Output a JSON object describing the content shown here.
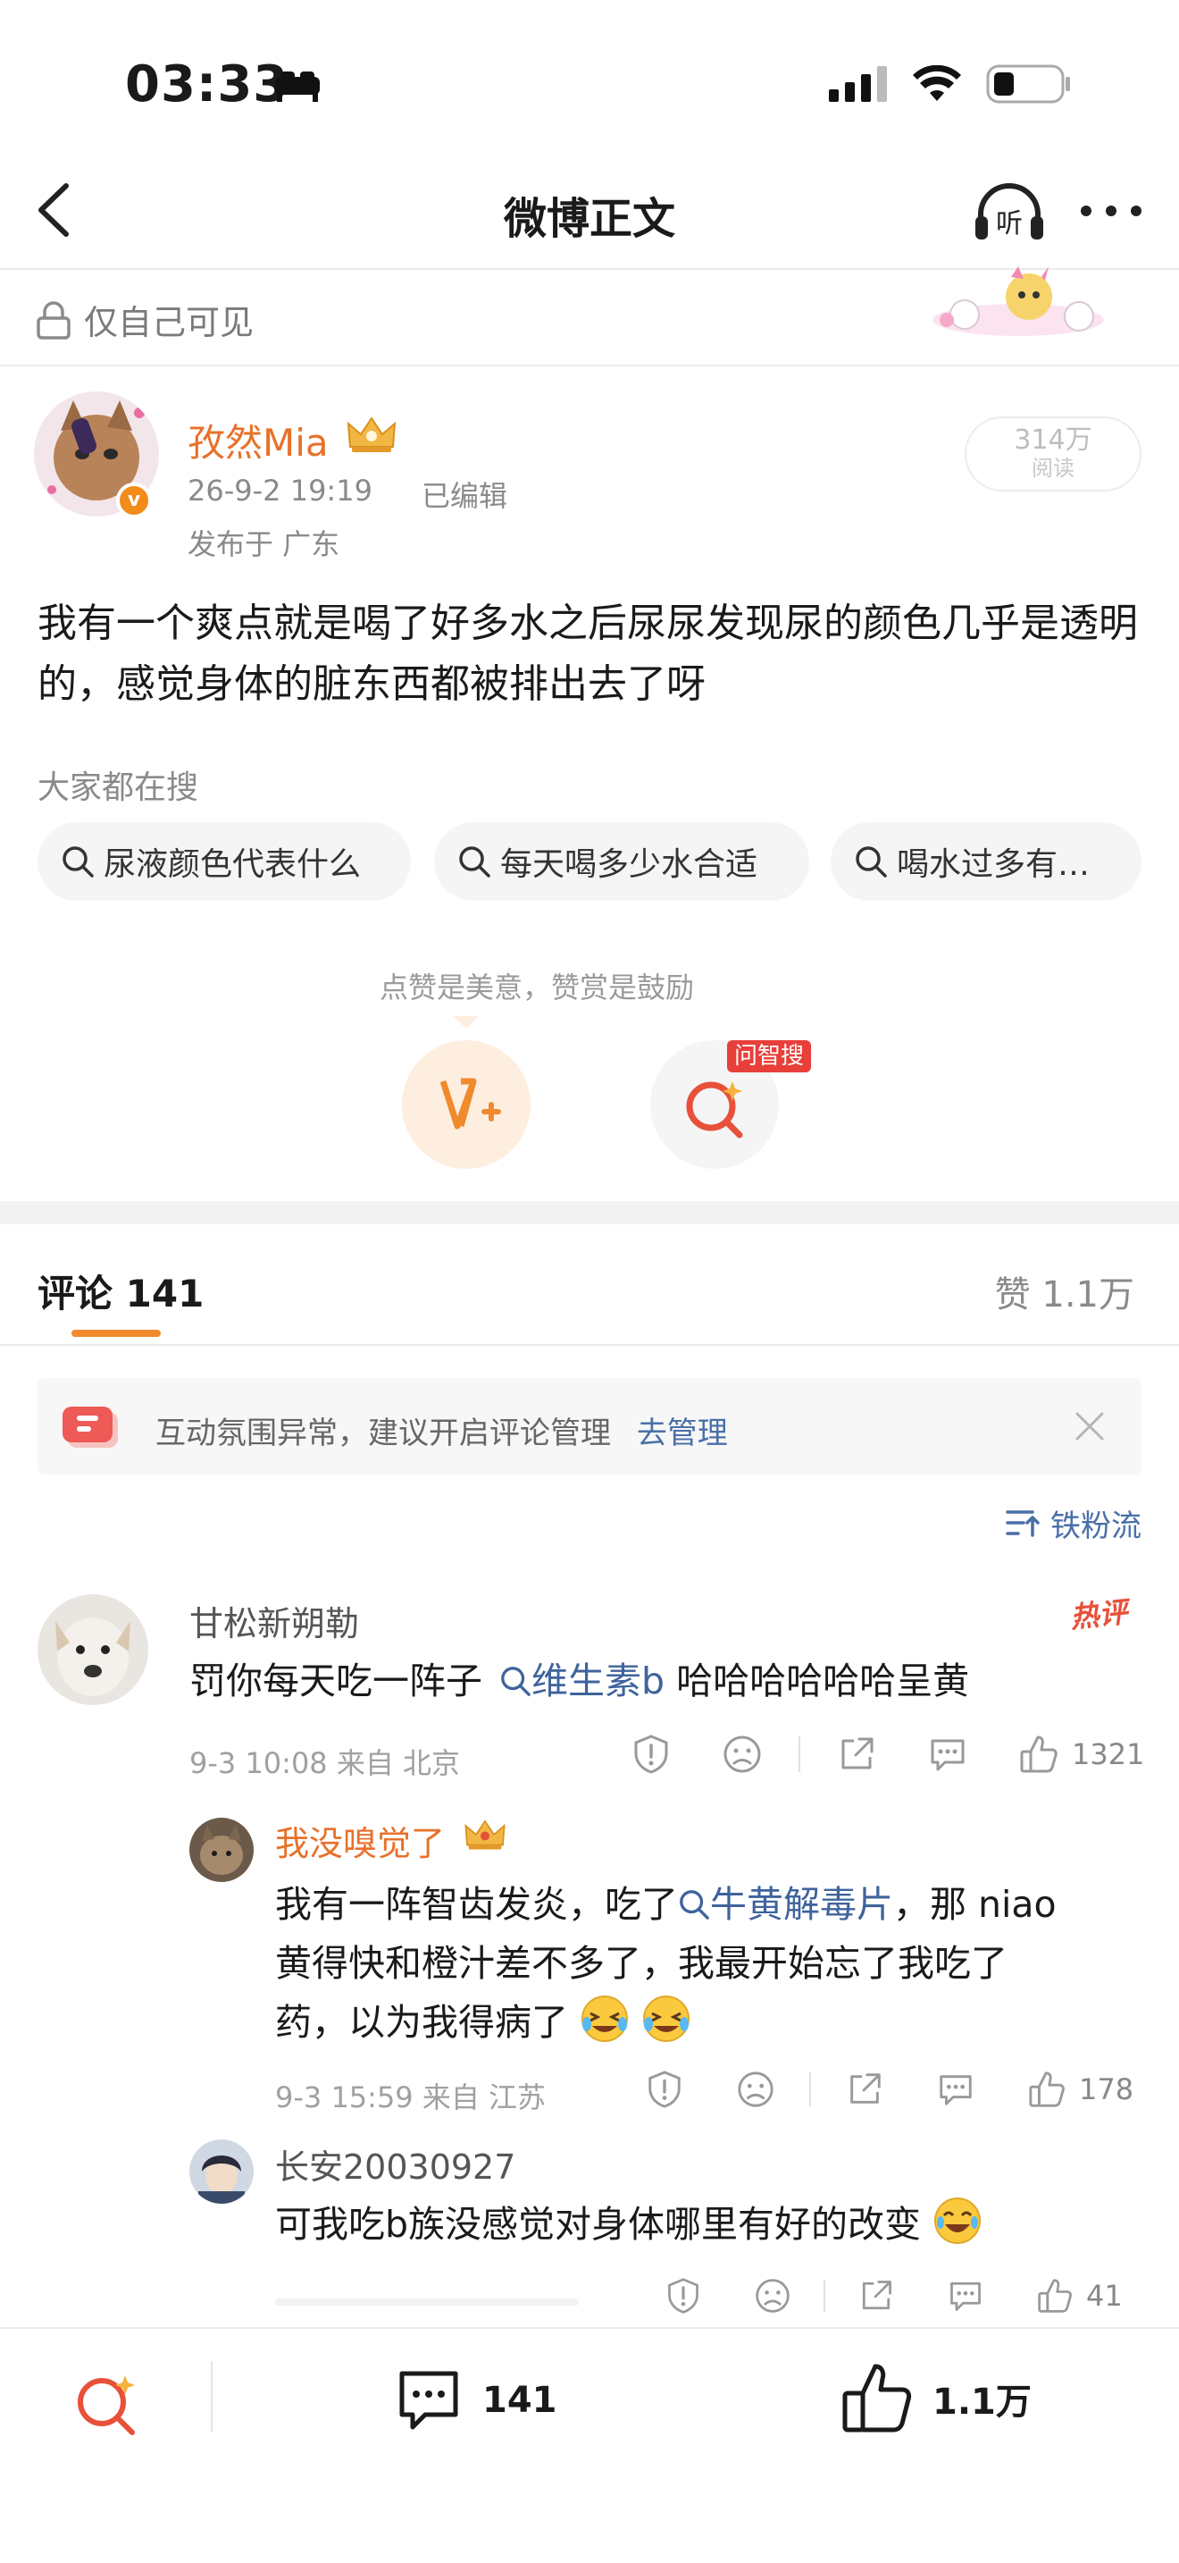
{
  "status": {
    "time": "03:33"
  },
  "nav": {
    "title": "微博正文"
  },
  "privacy": {
    "label": "仅自己可见"
  },
  "post": {
    "author": "孜然Mia",
    "time": "26-9-2 19:19",
    "edited": "已编辑",
    "location": "发布于 广东",
    "reads_number": "314万",
    "reads_label": "阅读",
    "body": "我有一个爽点就是喝了好多水之后尿尿发现尿的颜色几乎是透明的，感觉身体的脏东西都被排出去了呀"
  },
  "search": {
    "title": "大家都在搜",
    "chips": [
      "尿液颜色代表什么",
      "每天喝多少水合适",
      "喝水过多有…"
    ]
  },
  "reward": {
    "hint": "点赞是美意，赞赏是鼓励",
    "ai_tag": "问智搜"
  },
  "comments_header": {
    "tab_label": "评论 141",
    "likes_label": "赞 1.1万"
  },
  "notice": {
    "text": "互动氛围异常，建议开启评论管理",
    "link": "去管理"
  },
  "sort": {
    "label": "铁粉流"
  },
  "comments": [
    {
      "name": "甘松新朔勒",
      "badge": "热评",
      "text_before": "罚你每天吃一阵子",
      "link": "维生素b",
      "text_after": " 哈哈哈哈哈哈呈黄",
      "meta": "9-3 10:08  来自 北京",
      "likes": "1321"
    },
    {
      "name": "我没嗅觉了",
      "text_line1_before": "我有一阵智齿发炎，吃了",
      "link": "牛黄解毒片",
      "text_line1_after": "，那 niao",
      "text_line2": "黄得快和橙汁差不多了，我最开始忘了我吃了",
      "text_line3": "药，以为我得病了",
      "meta": "9-3 15:59  来自 江苏",
      "likes": "178"
    },
    {
      "name": "长安20030927",
      "text": "可我吃b族没感觉对身体哪里有好的改变",
      "likes": "41"
    }
  ],
  "bottom": {
    "comments": "141",
    "likes": "1.1万"
  },
  "colors": {
    "accent_orange": "#f08a2d",
    "link_blue": "#4a6fa8",
    "hot_red": "#e8503a"
  }
}
